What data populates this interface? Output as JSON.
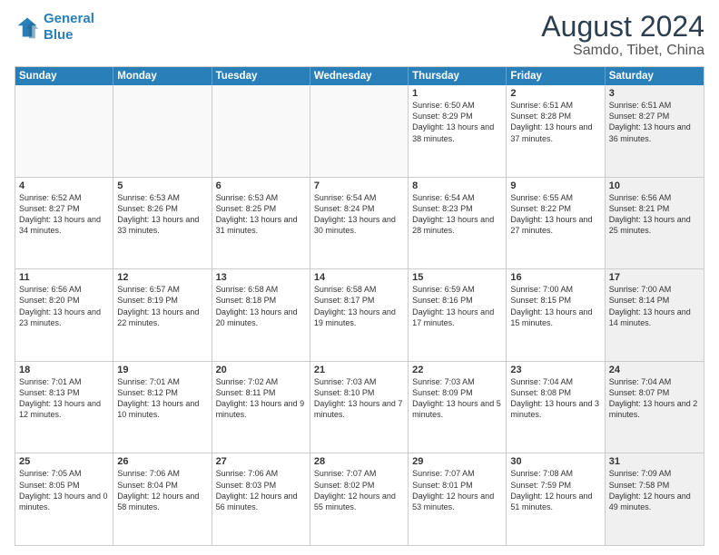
{
  "header": {
    "logo_line1": "General",
    "logo_line2": "Blue",
    "main_title": "August 2024",
    "subtitle": "Samdo, Tibet, China"
  },
  "weekdays": [
    "Sunday",
    "Monday",
    "Tuesday",
    "Wednesday",
    "Thursday",
    "Friday",
    "Saturday"
  ],
  "weeks": [
    [
      {
        "day": "",
        "info": "",
        "empty": true
      },
      {
        "day": "",
        "info": "",
        "empty": true
      },
      {
        "day": "",
        "info": "",
        "empty": true
      },
      {
        "day": "",
        "info": "",
        "empty": true
      },
      {
        "day": "1",
        "info": "Sunrise: 6:50 AM\nSunset: 8:29 PM\nDaylight: 13 hours\nand 38 minutes."
      },
      {
        "day": "2",
        "info": "Sunrise: 6:51 AM\nSunset: 8:28 PM\nDaylight: 13 hours\nand 37 minutes."
      },
      {
        "day": "3",
        "info": "Sunrise: 6:51 AM\nSunset: 8:27 PM\nDaylight: 13 hours\nand 36 minutes.",
        "shaded": true
      }
    ],
    [
      {
        "day": "4",
        "info": "Sunrise: 6:52 AM\nSunset: 8:27 PM\nDaylight: 13 hours\nand 34 minutes."
      },
      {
        "day": "5",
        "info": "Sunrise: 6:53 AM\nSunset: 8:26 PM\nDaylight: 13 hours\nand 33 minutes."
      },
      {
        "day": "6",
        "info": "Sunrise: 6:53 AM\nSunset: 8:25 PM\nDaylight: 13 hours\nand 31 minutes."
      },
      {
        "day": "7",
        "info": "Sunrise: 6:54 AM\nSunset: 8:24 PM\nDaylight: 13 hours\nand 30 minutes."
      },
      {
        "day": "8",
        "info": "Sunrise: 6:54 AM\nSunset: 8:23 PM\nDaylight: 13 hours\nand 28 minutes."
      },
      {
        "day": "9",
        "info": "Sunrise: 6:55 AM\nSunset: 8:22 PM\nDaylight: 13 hours\nand 27 minutes."
      },
      {
        "day": "10",
        "info": "Sunrise: 6:56 AM\nSunset: 8:21 PM\nDaylight: 13 hours\nand 25 minutes.",
        "shaded": true
      }
    ],
    [
      {
        "day": "11",
        "info": "Sunrise: 6:56 AM\nSunset: 8:20 PM\nDaylight: 13 hours\nand 23 minutes."
      },
      {
        "day": "12",
        "info": "Sunrise: 6:57 AM\nSunset: 8:19 PM\nDaylight: 13 hours\nand 22 minutes."
      },
      {
        "day": "13",
        "info": "Sunrise: 6:58 AM\nSunset: 8:18 PM\nDaylight: 13 hours\nand 20 minutes."
      },
      {
        "day": "14",
        "info": "Sunrise: 6:58 AM\nSunset: 8:17 PM\nDaylight: 13 hours\nand 19 minutes."
      },
      {
        "day": "15",
        "info": "Sunrise: 6:59 AM\nSunset: 8:16 PM\nDaylight: 13 hours\nand 17 minutes."
      },
      {
        "day": "16",
        "info": "Sunrise: 7:00 AM\nSunset: 8:15 PM\nDaylight: 13 hours\nand 15 minutes."
      },
      {
        "day": "17",
        "info": "Sunrise: 7:00 AM\nSunset: 8:14 PM\nDaylight: 13 hours\nand 14 minutes.",
        "shaded": true
      }
    ],
    [
      {
        "day": "18",
        "info": "Sunrise: 7:01 AM\nSunset: 8:13 PM\nDaylight: 13 hours\nand 12 minutes."
      },
      {
        "day": "19",
        "info": "Sunrise: 7:01 AM\nSunset: 8:12 PM\nDaylight: 13 hours\nand 10 minutes."
      },
      {
        "day": "20",
        "info": "Sunrise: 7:02 AM\nSunset: 8:11 PM\nDaylight: 13 hours\nand 9 minutes."
      },
      {
        "day": "21",
        "info": "Sunrise: 7:03 AM\nSunset: 8:10 PM\nDaylight: 13 hours\nand 7 minutes."
      },
      {
        "day": "22",
        "info": "Sunrise: 7:03 AM\nSunset: 8:09 PM\nDaylight: 13 hours\nand 5 minutes."
      },
      {
        "day": "23",
        "info": "Sunrise: 7:04 AM\nSunset: 8:08 PM\nDaylight: 13 hours\nand 3 minutes."
      },
      {
        "day": "24",
        "info": "Sunrise: 7:04 AM\nSunset: 8:07 PM\nDaylight: 13 hours\nand 2 minutes.",
        "shaded": true
      }
    ],
    [
      {
        "day": "25",
        "info": "Sunrise: 7:05 AM\nSunset: 8:05 PM\nDaylight: 13 hours\nand 0 minutes."
      },
      {
        "day": "26",
        "info": "Sunrise: 7:06 AM\nSunset: 8:04 PM\nDaylight: 12 hours\nand 58 minutes."
      },
      {
        "day": "27",
        "info": "Sunrise: 7:06 AM\nSunset: 8:03 PM\nDaylight: 12 hours\nand 56 minutes."
      },
      {
        "day": "28",
        "info": "Sunrise: 7:07 AM\nSunset: 8:02 PM\nDaylight: 12 hours\nand 55 minutes."
      },
      {
        "day": "29",
        "info": "Sunrise: 7:07 AM\nSunset: 8:01 PM\nDaylight: 12 hours\nand 53 minutes."
      },
      {
        "day": "30",
        "info": "Sunrise: 7:08 AM\nSunset: 7:59 PM\nDaylight: 12 hours\nand 51 minutes."
      },
      {
        "day": "31",
        "info": "Sunrise: 7:09 AM\nSunset: 7:58 PM\nDaylight: 12 hours\nand 49 minutes.",
        "shaded": true
      }
    ]
  ]
}
